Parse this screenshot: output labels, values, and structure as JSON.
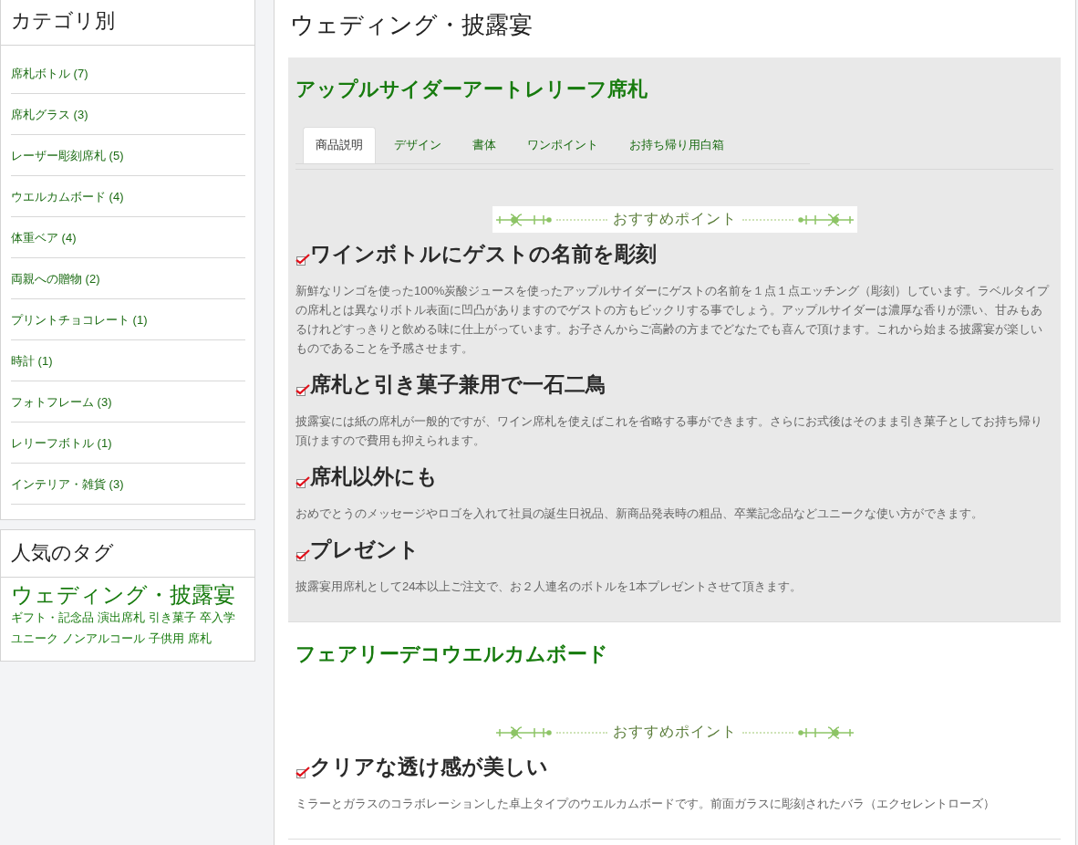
{
  "sidebar": {
    "categories": {
      "title": "カテゴリ別",
      "items": [
        {
          "label": "席札ボトル (7)"
        },
        {
          "label": "席札グラス (3)"
        },
        {
          "label": "レーザー彫刻席札 (5)"
        },
        {
          "label": "ウエルカムボード (4)"
        },
        {
          "label": "体重ベア (4)"
        },
        {
          "label": "両親への贈物 (2)"
        },
        {
          "label": "プリントチョコレート (1)"
        },
        {
          "label": "時計 (1)"
        },
        {
          "label": "フォトフレーム (3)"
        },
        {
          "label": "レリーフボトル (1)"
        },
        {
          "label": "インテリア・雑貨 (3)"
        }
      ]
    },
    "tags": {
      "title": "人気のタグ",
      "items": [
        {
          "label": "ウェディング・披露宴",
          "kind": "large"
        },
        {
          "label": "ギフト・記念品",
          "kind": "small"
        },
        {
          "label": "演出席札",
          "kind": "small"
        },
        {
          "label": "引き菓子",
          "kind": "small"
        },
        {
          "label": "卒入学",
          "kind": "small"
        },
        {
          "label": "ユニーク",
          "kind": "small"
        },
        {
          "label": "ノンアルコール",
          "kind": "small"
        },
        {
          "label": "子供用",
          "kind": "small"
        },
        {
          "label": "席札",
          "kind": "small"
        }
      ]
    }
  },
  "main": {
    "title": "ウェディング・披露宴",
    "products": [
      {
        "title": "アップルサイダーアートレリーフ席札",
        "selected": true,
        "tabs": [
          {
            "label": "商品説明",
            "selected": true
          },
          {
            "label": "デザイン",
            "selected": false
          },
          {
            "label": "書体",
            "selected": false
          },
          {
            "label": "ワンポイント",
            "selected": false
          },
          {
            "label": "お持ち帰り用白箱",
            "selected": false
          }
        ],
        "banner": "おすすめポイント",
        "points": [
          {
            "heading": "ワインボトルにゲストの名前を彫刻",
            "text": "新鮮なリンゴを使った100%炭酸ジュースを使ったアップルサイダーにゲストの名前を１点１点エッチング（彫刻）しています。ラベルタイプの席札とは異なりボトル表面に凹凸がありますのでゲストの方もビックリする事でしょう。アップルサイダーは濃厚な香りが漂い、甘みもあるけれどすっきりと飲める味に仕上がっています。お子さんからご高齢の方までどなたでも喜んで頂けます。これから始まる披露宴が楽しいものであることを予感させます。"
          },
          {
            "heading": "席札と引き菓子兼用で一石二鳥",
            "text": "披露宴には紙の席札が一般的ですが、ワイン席札を使えばこれを省略する事ができます。さらにお式後はそのまま引き菓子としてお持ち帰り頂けますので費用も抑えられます。"
          },
          {
            "heading": "席札以外にも",
            "text": "おめでとうのメッセージやロゴを入れて社員の誕生日祝品、新商品発表時の粗品、卒業記念品などユニークな使い方ができます。"
          },
          {
            "heading": "プレゼント",
            "text": "披露宴用席札として24本以上ご注文で、お２人連名のボトルを1本プレゼントさせて頂きます。"
          }
        ]
      },
      {
        "title": "フェアリーデコウエルカムボード",
        "selected": false,
        "banner": "おすすめポイント",
        "points": [
          {
            "heading": "クリアな透け感が美しい",
            "text": "ミラーとガラスのコラボレーションした卓上タイプのウエルカムボードです。前面ガラスに彫刻されたバラ（エクセレントローズ）"
          }
        ]
      }
    ]
  }
}
